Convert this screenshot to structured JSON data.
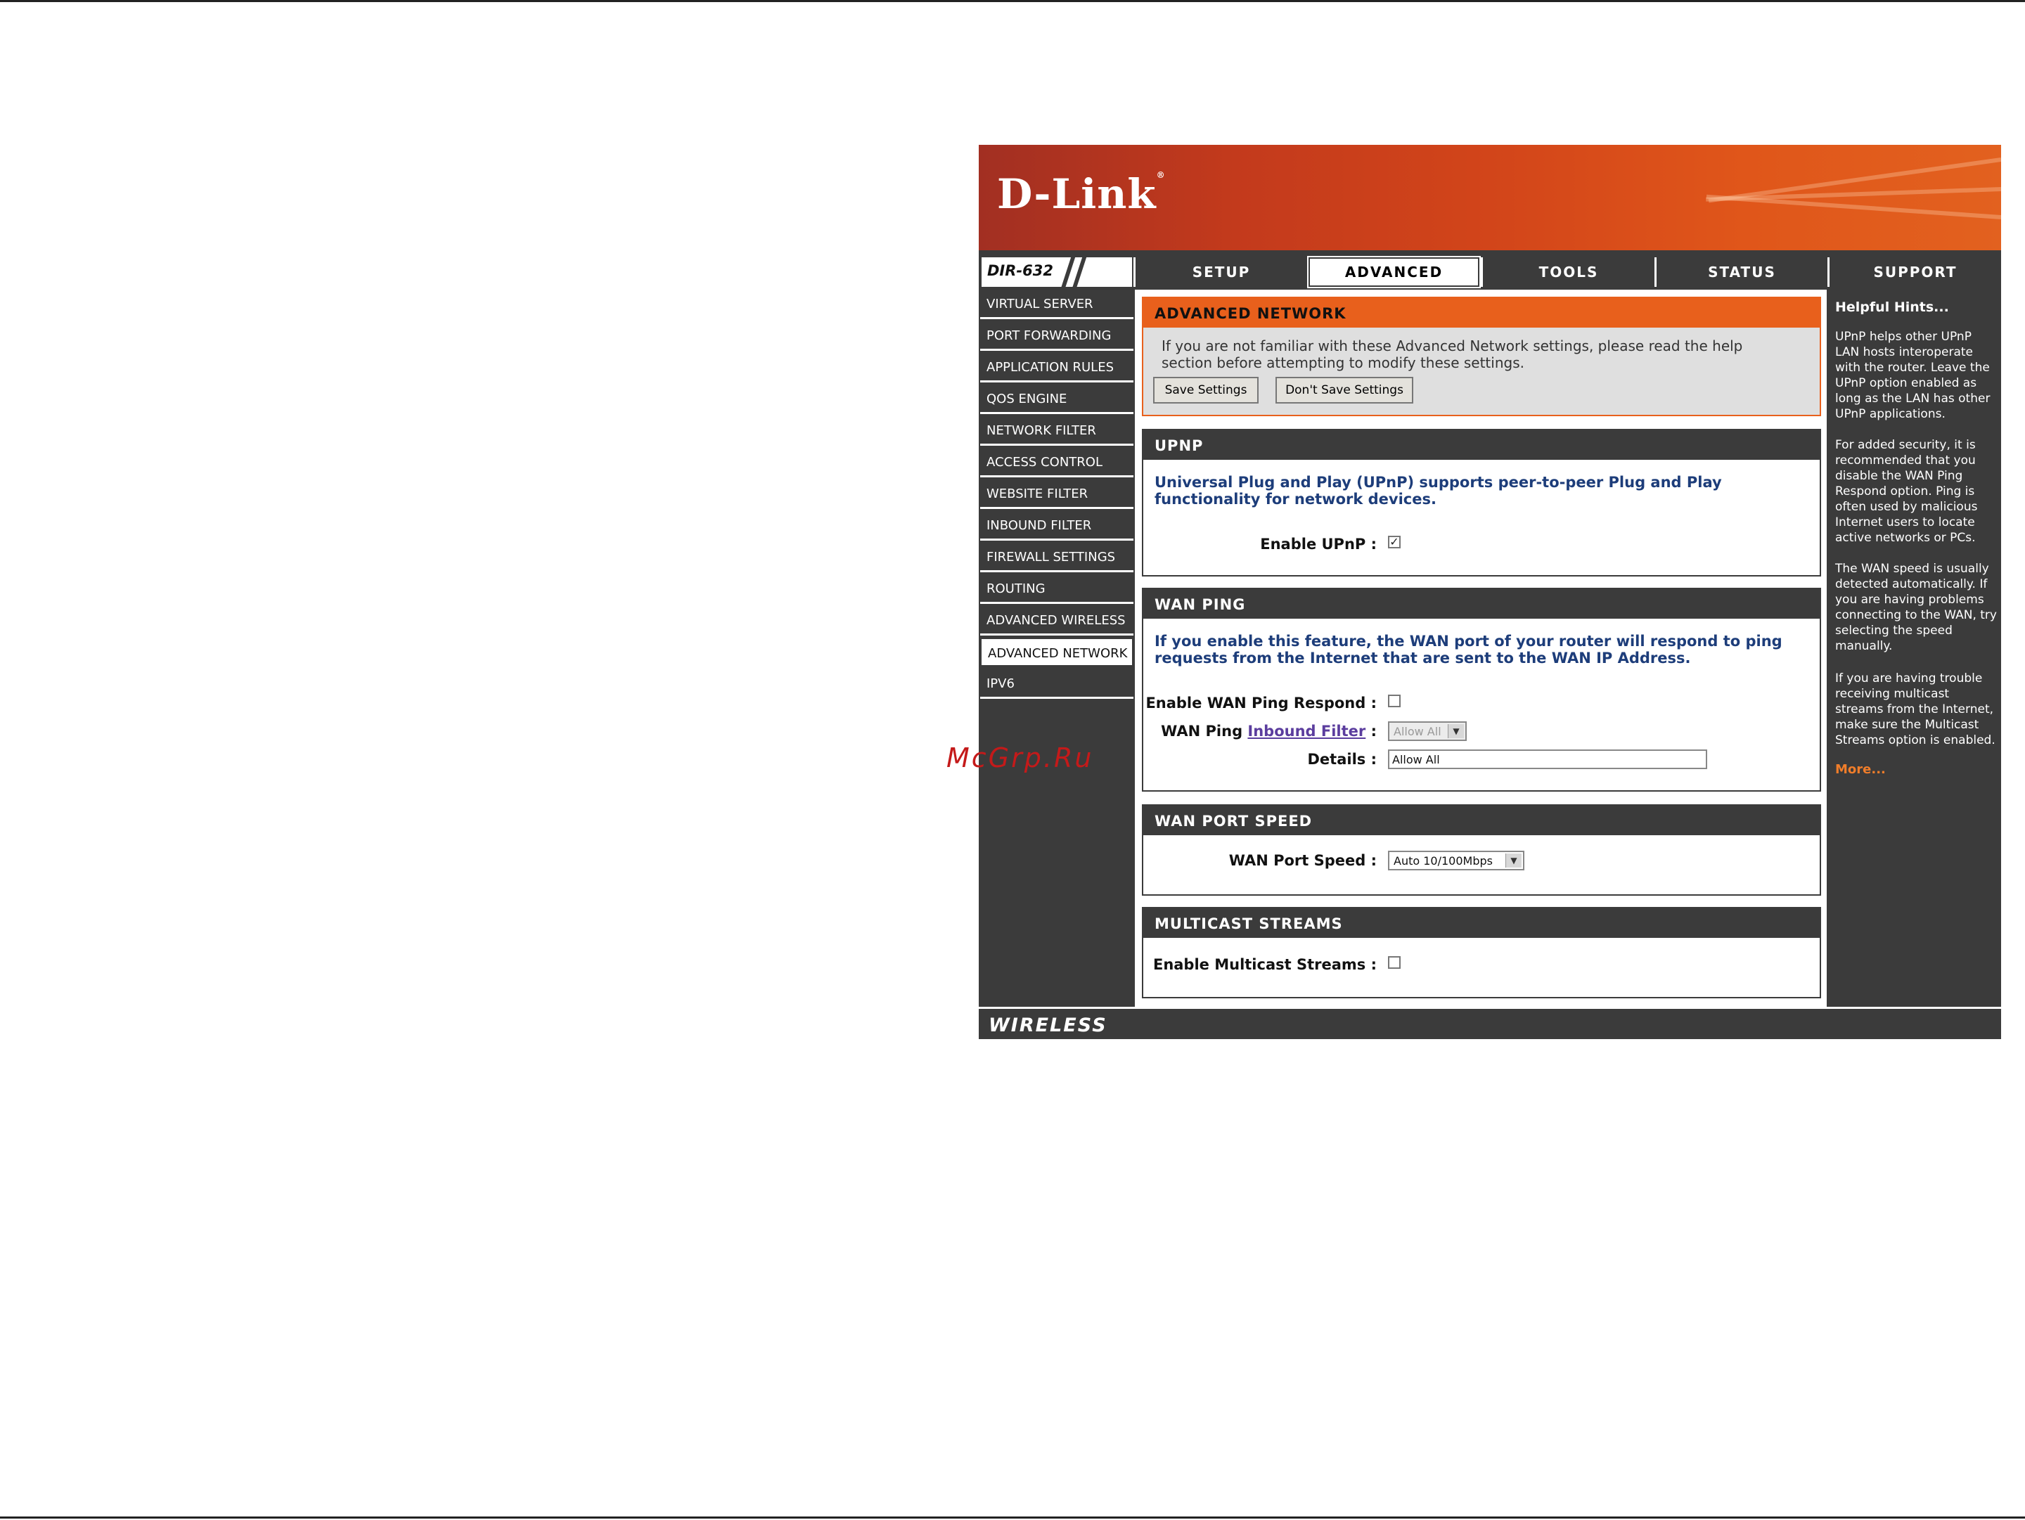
{
  "header": {
    "logo": "D-Link",
    "model": "DIR-632"
  },
  "nav": {
    "tabs": [
      {
        "label": "SETUP",
        "active": false
      },
      {
        "label": "ADVANCED",
        "active": true
      },
      {
        "label": "TOOLS",
        "active": false
      },
      {
        "label": "STATUS",
        "active": false
      },
      {
        "label": "SUPPORT",
        "active": false
      }
    ]
  },
  "sidebar": {
    "items": [
      {
        "label": "VIRTUAL SERVER"
      },
      {
        "label": "PORT FORWARDING"
      },
      {
        "label": "APPLICATION RULES"
      },
      {
        "label": "QOS ENGINE"
      },
      {
        "label": "NETWORK FILTER"
      },
      {
        "label": "ACCESS CONTROL"
      },
      {
        "label": "WEBSITE FILTER"
      },
      {
        "label": "INBOUND FILTER"
      },
      {
        "label": "FIREWALL SETTINGS"
      },
      {
        "label": "ROUTING"
      },
      {
        "label": "ADVANCED WIRELESS"
      },
      {
        "label": "ADVANCED NETWORK",
        "active": true
      },
      {
        "label": "IPV6"
      }
    ]
  },
  "advanced": {
    "title": "ADVANCED NETWORK",
    "text": "If you are not familiar with these Advanced Network settings, please read the help section before attempting to modify these settings.",
    "save_label": "Save Settings",
    "dont_save_label": "Don't Save Settings"
  },
  "upnp": {
    "title": "UPNP",
    "description": "Universal Plug and Play (UPnP) supports peer-to-peer Plug and Play functionality for network devices.",
    "enable_label": "Enable UPnP :",
    "enabled": true,
    "check_glyph": "✓"
  },
  "wan_ping": {
    "title": "WAN PING",
    "description": "If you enable this feature, the WAN port of your router will respond to ping requests from the Internet that are sent to the WAN IP Address.",
    "respond_label": "Enable WAN Ping Respond :",
    "respond_enabled": false,
    "filter_label_prefix": "WAN Ping",
    "filter_link": "Inbound Filter",
    "filter_label_suffix": ":",
    "filter_value": "Allow All",
    "details_label": "Details :",
    "details_value": "Allow All"
  },
  "wan_port_speed": {
    "title": "WAN PORT SPEED",
    "label": "WAN Port Speed :",
    "value": "Auto 10/100Mbps"
  },
  "multicast": {
    "title": "MULTICAST STREAMS",
    "label": "Enable Multicast Streams :",
    "enabled": false
  },
  "hints": {
    "title": "Helpful Hints...",
    "items": [
      "UPnP helps other UPnP LAN hosts interoperate with the router. Leave the UPnP option enabled as long as the LAN has other UPnP applications.",
      "For added security, it is recommended that you disable the WAN Ping Respond option. Ping is often used by malicious Internet users to locate active networks or PCs.",
      "The WAN speed is usually detected automatically. If you are having problems connecting to the WAN, try selecting the speed manually.",
      "If you are having trouble receiving multicast streams from the Internet, make sure the Multicast Streams option is enabled."
    ],
    "more": "More..."
  },
  "footer": {
    "label": "WIRELESS"
  },
  "watermark": "McGrp.Ru",
  "colors": {
    "brand_orange": "#e8601c",
    "dark_panel": "#3b3b3b",
    "desc_blue": "#1d3d7a",
    "link_purple": "#5b3d9e"
  },
  "icons": {
    "select_arrow": "chevron-down-icon",
    "checkbox": "checkbox-icon"
  }
}
